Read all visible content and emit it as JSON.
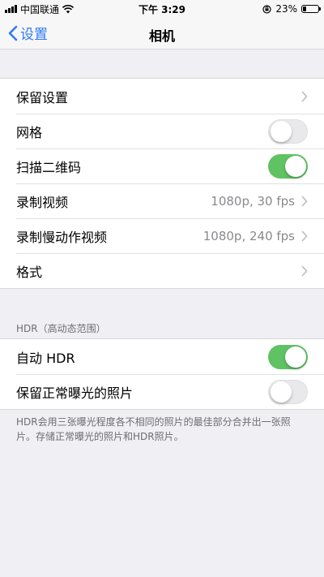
{
  "status_bar": {
    "carrier": "中国联通",
    "time": "下午 3:29",
    "battery_percent": "23%",
    "battery_level": 0.23
  },
  "nav": {
    "back_label": "设置",
    "title": "相机"
  },
  "group1": {
    "rows": [
      {
        "label": "保留设置",
        "type": "link"
      },
      {
        "label": "网格",
        "type": "toggle",
        "on": false
      },
      {
        "label": "扫描二维码",
        "type": "toggle",
        "on": true
      },
      {
        "label": "录制视频",
        "type": "link",
        "value": "1080p, 30 fps"
      },
      {
        "label": "录制慢动作视频",
        "type": "link",
        "value": "1080p, 240 fps"
      },
      {
        "label": "格式",
        "type": "link"
      }
    ]
  },
  "hdr_section": {
    "header": "HDR（高动态范围）",
    "rows": [
      {
        "label": "自动 HDR",
        "type": "toggle",
        "on": true
      },
      {
        "label": "保留正常曝光的照片",
        "type": "toggle",
        "on": false
      }
    ],
    "footer": "HDR会用三张曝光程度各不相同的照片的最佳部分合并出一张照片。存储正常曝光的照片和HDR照片。"
  },
  "colors": {
    "accent": "#2f7bf5",
    "toggle_on": "#5fc263",
    "background": "#efeff4"
  }
}
